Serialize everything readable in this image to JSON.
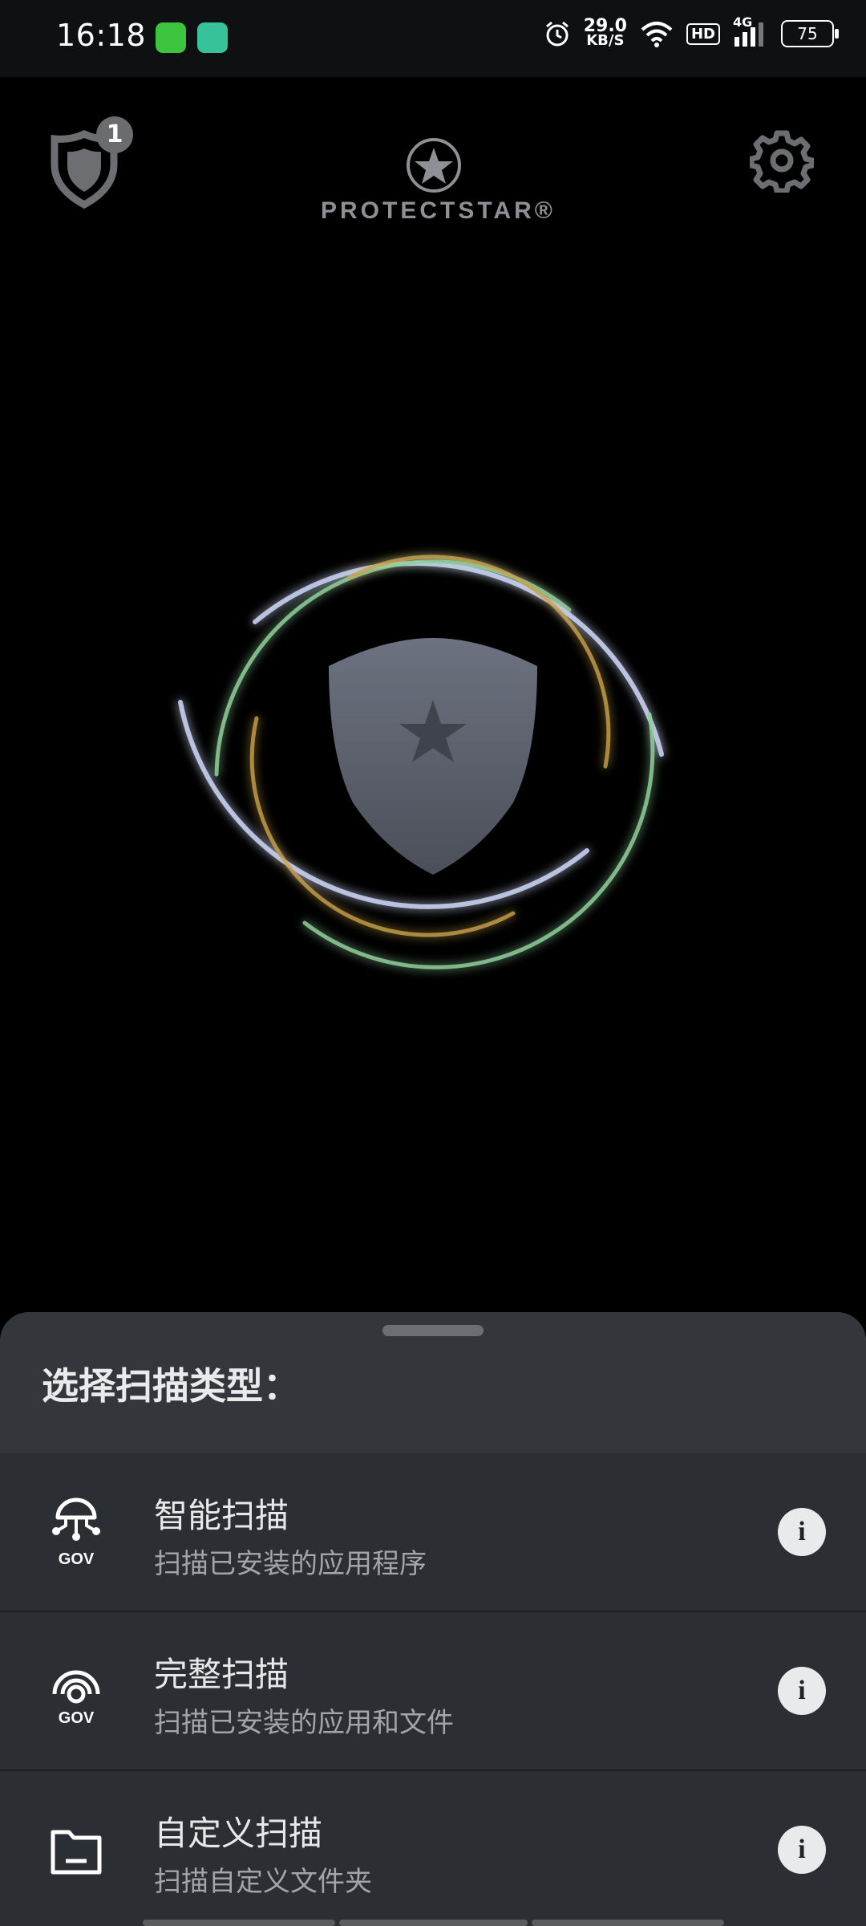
{
  "status_bar": {
    "time": "16:18",
    "net_speed_value": "29.0",
    "net_speed_unit": "KB/S",
    "hd": "HD",
    "signal_label": "4G",
    "battery": "75",
    "icons": [
      "chat-app-icon",
      "wallet-app-icon",
      "alarm-icon",
      "wifi-icon",
      "signal-icon",
      "battery-icon"
    ]
  },
  "header": {
    "notification_count": "1",
    "logo_text": "PROTECTSTAR®"
  },
  "sheet": {
    "title": "选择扫描类型：",
    "items": [
      {
        "title": "智能扫描",
        "subtitle": "扫描已安装的应用程序",
        "badge": "GOV",
        "icon": "smart-scan-icon"
      },
      {
        "title": "完整扫描",
        "subtitle": "扫描已安装的应用和文件",
        "badge": "GOV",
        "icon": "full-scan-icon"
      },
      {
        "title": "自定义扫描",
        "subtitle": "扫描自定义文件夹",
        "icon": "folder-icon"
      }
    ]
  },
  "colors": {
    "sheet_bg": "#2b2e33",
    "sheet_header_bg": "#33373c",
    "ring_blue": "#b8c4e6",
    "ring_green": "#8fcf9a",
    "ring_gold": "#c9a24a",
    "shield": "#5f6470"
  }
}
